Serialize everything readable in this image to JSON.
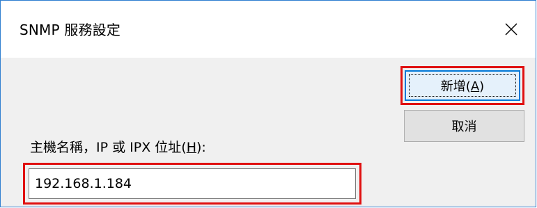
{
  "window": {
    "title": "SNMP 服務設定",
    "close_glyph": "close-icon"
  },
  "buttons": {
    "add": {
      "label": "新增",
      "mnemonic_open": "(",
      "mnemonic": "A",
      "mnemonic_close": ")"
    },
    "cancel": {
      "label": "取消"
    }
  },
  "host_field": {
    "label": "主機名稱，IP 或 IPX 位址",
    "mnemonic_open": "(",
    "mnemonic": "H",
    "mnemonic_close": "):",
    "value": "192.168.1.184"
  },
  "colors": {
    "highlight": "#e01010",
    "window_border": "#2f7fd0",
    "focus_blue": "#0078d7"
  }
}
